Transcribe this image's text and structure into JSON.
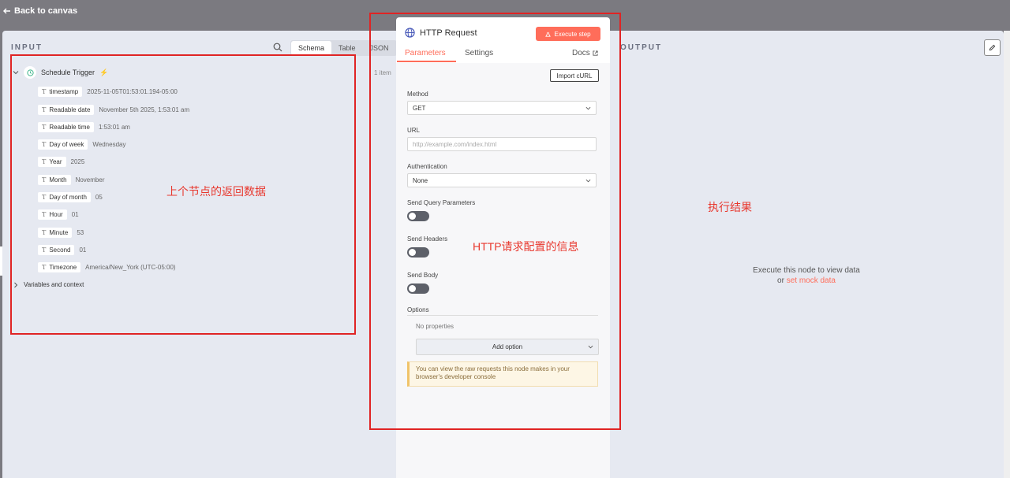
{
  "header": {
    "back_label": "Back to canvas"
  },
  "input_panel": {
    "title": "INPUT",
    "tabs": [
      "Schema",
      "Table",
      "JSON"
    ],
    "active_tab": "Schema",
    "items_count": "1 item",
    "trigger_name": "Schedule Trigger",
    "fields": [
      {
        "key": "timestamp",
        "value": "2025-11-05T01:53:01.194-05:00"
      },
      {
        "key": "Readable date",
        "value": "November 5th 2025, 1:53:01 am"
      },
      {
        "key": "Readable time",
        "value": "1:53:01 am"
      },
      {
        "key": "Day of week",
        "value": "Wednesday"
      },
      {
        "key": "Year",
        "value": "2025"
      },
      {
        "key": "Month",
        "value": "November"
      },
      {
        "key": "Day of month",
        "value": "05"
      },
      {
        "key": "Hour",
        "value": "01"
      },
      {
        "key": "Minute",
        "value": "53"
      },
      {
        "key": "Second",
        "value": "01"
      },
      {
        "key": "Timezone",
        "value": "America/New_York (UTC-05:00)"
      }
    ],
    "variables_label": "Variables and context"
  },
  "node_panel": {
    "title": "HTTP Request",
    "execute_label": "Execute step",
    "tabs": {
      "parameters": "Parameters",
      "settings": "Settings"
    },
    "docs_label": "Docs",
    "import_curl_label": "Import cURL",
    "method": {
      "label": "Method",
      "value": "GET"
    },
    "url": {
      "label": "URL",
      "placeholder": "http://example.com/index.html"
    },
    "authentication": {
      "label": "Authentication",
      "value": "None"
    },
    "send_query_label": "Send Query Parameters",
    "send_headers_label": "Send Headers",
    "send_body_label": "Send Body",
    "options_label": "Options",
    "no_properties": "No properties",
    "add_option_label": "Add option",
    "notice_text": "You can view the raw requests this node makes in your browser's developer console"
  },
  "output_panel": {
    "title": "OUTPUT",
    "message": "Execute this node to view data",
    "or_text": "or",
    "mock_link": "set mock data"
  },
  "annotations": {
    "input_note": "上个节点的返回数据",
    "node_note": "HTTP请求配置的信息",
    "output_note": "执行结果"
  },
  "colors": {
    "accent": "#ff6d5a",
    "annotation": "#e02424",
    "panel_bg": "#e6e9f1"
  }
}
